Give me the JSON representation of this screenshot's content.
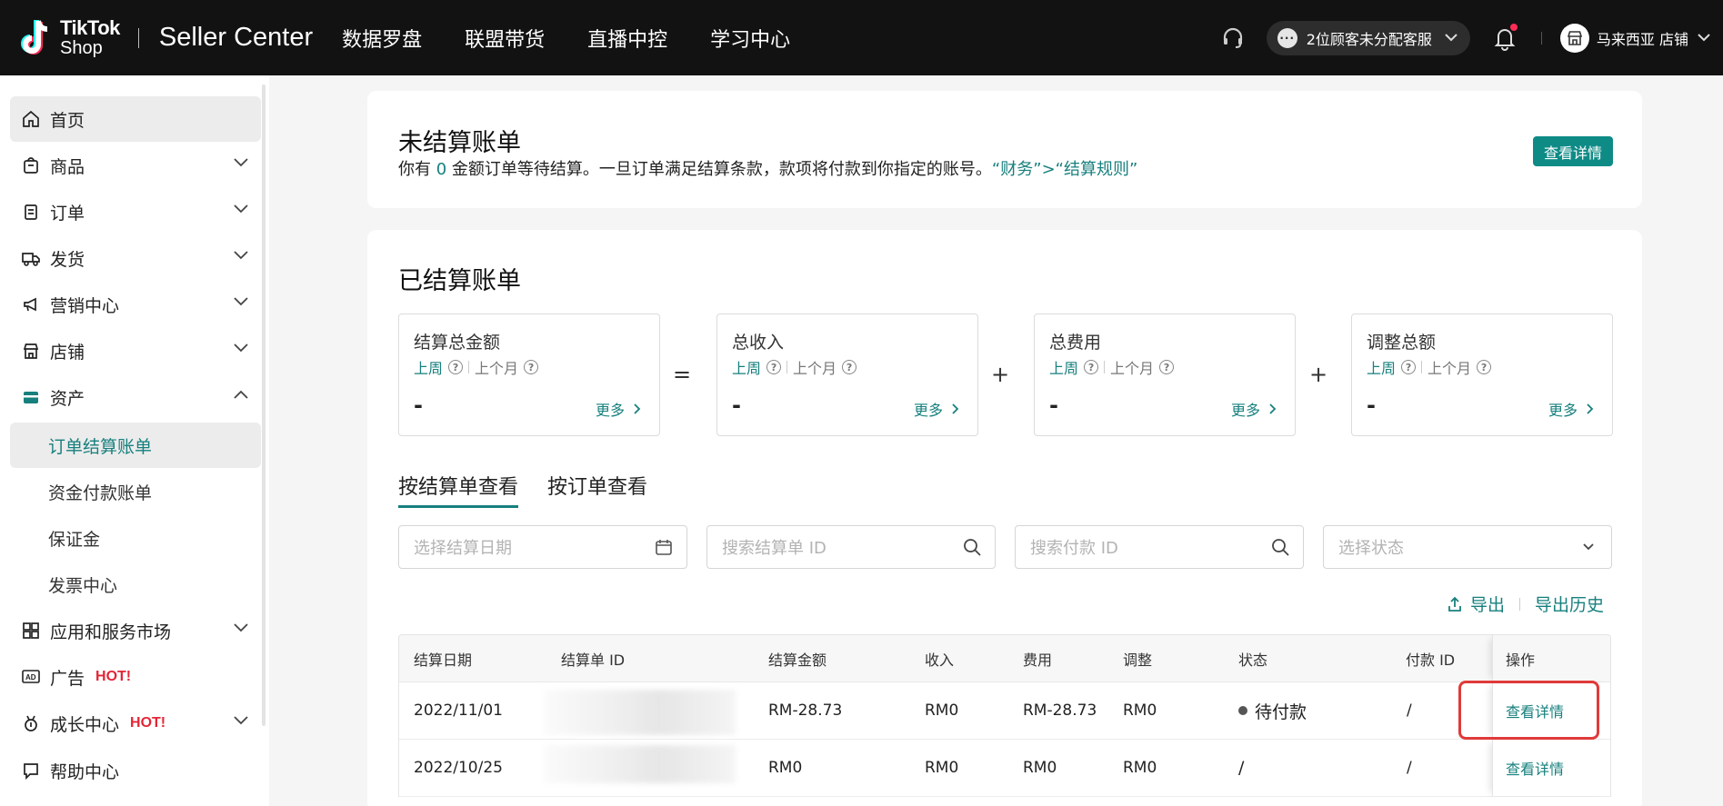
{
  "header": {
    "logo_line1": "TikTok",
    "logo_line2": "Shop",
    "app_title": "Seller Center",
    "nav": [
      "数据罗盘",
      "联盟带货",
      "直播中控",
      "学习中心"
    ],
    "cs_status": "2位顾客未分配客服",
    "store_name": "马来西亚 店铺"
  },
  "sidebar": {
    "items": [
      {
        "label": "首页",
        "icon": "home-icon"
      },
      {
        "label": "商品",
        "icon": "product-icon"
      },
      {
        "label": "订单",
        "icon": "order-icon"
      },
      {
        "label": "发货",
        "icon": "truck-icon"
      },
      {
        "label": "营销中心",
        "icon": "megaphone-icon"
      },
      {
        "label": "店铺",
        "icon": "shop-icon"
      },
      {
        "label": "资产",
        "icon": "wallet-icon"
      }
    ],
    "asset_sub": [
      "订单结算账单",
      "资金付款账单",
      "保证金",
      "发票中心"
    ],
    "items2": [
      {
        "label": "应用和服务市场",
        "icon": "apps-icon"
      },
      {
        "label": "广告",
        "icon": "ad-icon",
        "badge": "HOT!"
      },
      {
        "label": "成长中心",
        "icon": "growth-icon",
        "badge": "HOT!"
      },
      {
        "label": "帮助中心",
        "icon": "help-icon"
      }
    ]
  },
  "unsettled": {
    "title": "未结算账单",
    "desc_prefix": "你有",
    "count": "0",
    "desc_mid": "金额订单等待结算。一旦订单满足结算条款，款项将付款到你指定的账号。",
    "rule_link": "“财务”>“结算规则”",
    "detail_button": "查看详情"
  },
  "settled": {
    "title": "已结算账单",
    "metrics": [
      {
        "title": "结算总金额",
        "period1": "上周",
        "period2": "上个月",
        "value": "-",
        "more": "更多"
      },
      {
        "title": "总收入",
        "period1": "上周",
        "period2": "上个月",
        "value": "-",
        "more": "更多"
      },
      {
        "title": "总费用",
        "period1": "上周",
        "period2": "上个月",
        "value": "-",
        "more": "更多"
      },
      {
        "title": "调整总额",
        "period1": "上周",
        "period2": "上个月",
        "value": "-",
        "more": "更多"
      }
    ],
    "operators": [
      "=",
      "+",
      "+"
    ],
    "tabs": [
      "按结算单查看",
      "按订单查看"
    ],
    "filters": {
      "date_placeholder": "选择结算日期",
      "statement_id_placeholder": "搜索结算单 ID",
      "payment_id_placeholder": "搜索付款 ID",
      "status_placeholder": "选择状态"
    },
    "export": "导出",
    "export_history": "导出历史",
    "table": {
      "columns": [
        "结算日期",
        "结算单 ID",
        "结算金额",
        "收入",
        "费用",
        "调整",
        "状态",
        "付款 ID",
        "操作"
      ],
      "rows": [
        {
          "date": "2022/11/01",
          "amount": "RM-28.73",
          "income": "RM0",
          "fee": "RM-28.73",
          "adjust": "RM0",
          "status": "待付款",
          "payment_id": "/",
          "action": "查看详情"
        },
        {
          "date": "2022/10/25",
          "amount": "RM0",
          "income": "RM0",
          "fee": "RM0",
          "adjust": "RM0",
          "status": "/",
          "payment_id": "/",
          "action": "查看详情"
        }
      ]
    }
  },
  "colors": {
    "accent": "#17807e",
    "button": "#0f8b86",
    "topbar": "#121212",
    "hot": "#e32636",
    "highlight": "#e03a3a"
  }
}
